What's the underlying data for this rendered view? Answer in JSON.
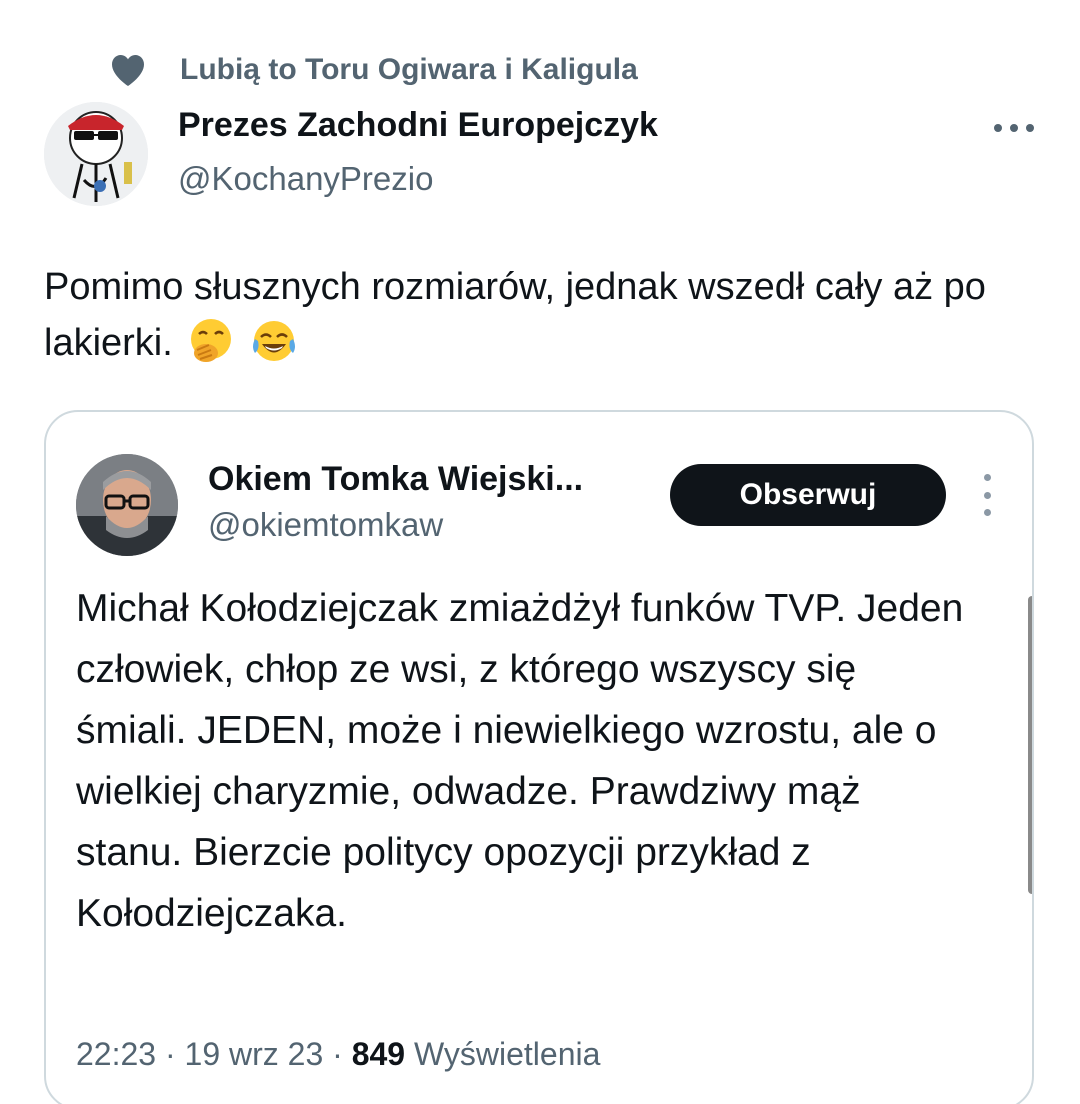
{
  "social_context": {
    "text": "Lubią to Toru Ogiwara i Kaligula",
    "icon": "heart-icon"
  },
  "author": {
    "name": "Prezes Zachodni Europejczyk",
    "handle": "@KochanyPrezio"
  },
  "tweet": {
    "text": "Pomimo słusznych rozmiarów, jednak wszedł cały aż po lakierki.",
    "emojis": [
      "face-with-hand-over-mouth",
      "face-with-tears-of-joy"
    ]
  },
  "quoted": {
    "name": "Okiem Tomka Wiejski...",
    "handle": "@okiemtomkaw",
    "follow_label": "Obserwuj",
    "text": "Michał Kołodziejczak zmiażdżył funków TVP. Jeden człowiek, chłop ze wsi, z którego wszyscy się śmiali. JEDEN, może i niewielkiego wzrostu, ale o wielkiej charyzmie, odwadze. Prawdziwy mąż stanu. Bierzcie politycy opozycji przykład z Kołodziejczaka.",
    "time": "22:23",
    "date": "19 wrz 23",
    "views_count": "849",
    "views_label": "Wyświetlenia",
    "separator": "·"
  },
  "colors": {
    "text_primary": "#0f1419",
    "text_secondary": "#536471",
    "border": "#cfd9de",
    "follow_bg": "#0f1419"
  }
}
